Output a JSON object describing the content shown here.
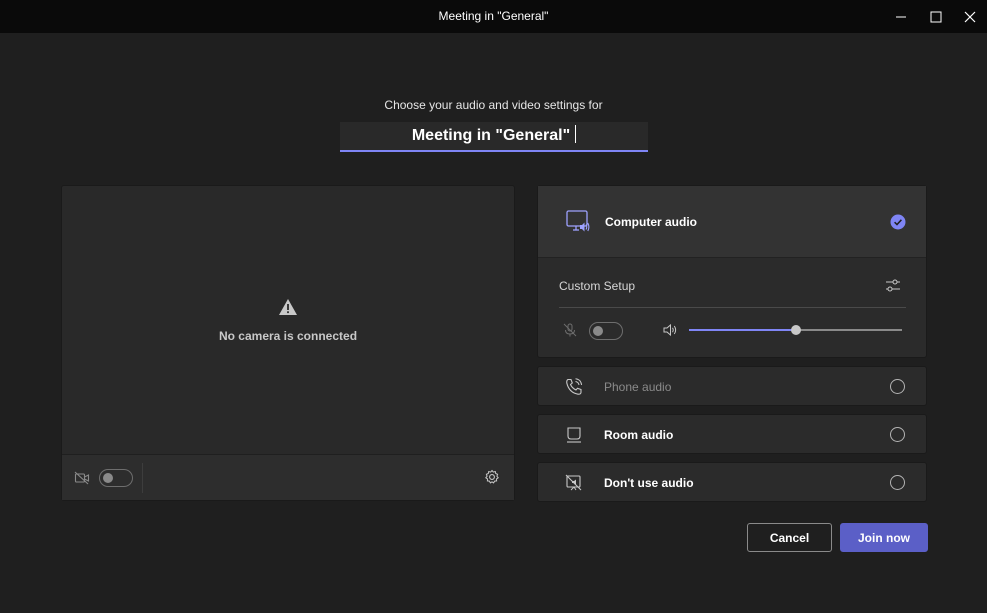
{
  "window": {
    "title": "Meeting in \"General\""
  },
  "header": {
    "subtitle": "Choose your audio and video settings for",
    "meeting_name": "Meeting in \"General\""
  },
  "video": {
    "no_camera_text": "No camera is connected",
    "camera_toggle_on": false
  },
  "audio": {
    "computer_audio": {
      "label": "Computer audio",
      "selected": true,
      "custom_setup_label": "Custom Setup",
      "mic_toggle_on": false,
      "speaker_volume": 0.5
    },
    "options": [
      {
        "label": "Phone audio",
        "enabled": false,
        "selected": false
      },
      {
        "label": "Room audio",
        "enabled": true,
        "selected": false
      },
      {
        "label": "Don't use audio",
        "enabled": true,
        "selected": false
      }
    ]
  },
  "actions": {
    "cancel_label": "Cancel",
    "join_label": "Join now"
  },
  "colors": {
    "accent": "#7f85f5",
    "primary_button": "#5b5fc7",
    "background": "#1f1f1f",
    "panel": "#292929"
  }
}
